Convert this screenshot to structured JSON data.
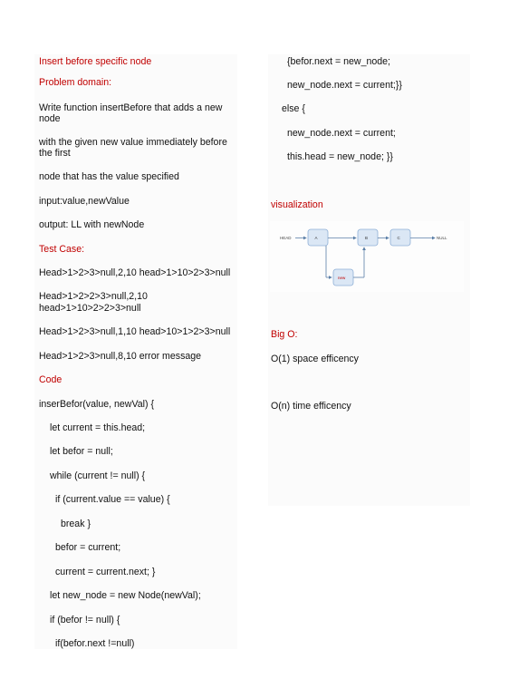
{
  "left": {
    "title": "Insert before specific node",
    "problem_domain_heading": "Problem domain:",
    "problem_line1_a": "Write function ",
    "problem_line1_b": "insertBefore that",
    "problem_line1_c": " adds a new node",
    "problem_line2": "with the given new value immediately before the first",
    "problem_line3": "node that has the value specified",
    "input": "input:value,newValue",
    "output": "output: LL with newNode",
    "test_case_heading": "Test Case:",
    "test1": "Head>1>2>3>null,2,10   head>1>10>2>3>null",
    "test2a": "Head>1>2>2>3>null,2,10",
    "test2b": "head>1>10>2>2>3>null",
    "test3": "Head>1>2>3>null,1,10   head>10>1>2>3>null",
    "test4": "Head>1>2>3>null,8,10   error message",
    "code_heading": "Code",
    "code": [
      "inserBefor(value, newVal) {",
      "let current = this.head;",
      "let befor = null;",
      "while (current != null) {",
      "if (current.value == value) {",
      "break      }",
      "befor = current;",
      "current = current.next;    }",
      "let new_node = new Node(newVal);",
      "if (befor != null) {",
      "if(befor.next !=null)"
    ]
  },
  "right": {
    "code": [
      "{befor.next = new_node;",
      "new_node.next = current;}}",
      "else {",
      "new_node.next = current;",
      "this.head = new_node;    }}"
    ],
    "visualization_heading": "visualization",
    "viz": {
      "head": "HEAD",
      "a": "A",
      "b": "B",
      "c": "C",
      "null": "NULL",
      "new": "new"
    },
    "big_o_heading": "Big O:",
    "space": "O(1) space efficency",
    "time": "O(n) time efficency"
  }
}
